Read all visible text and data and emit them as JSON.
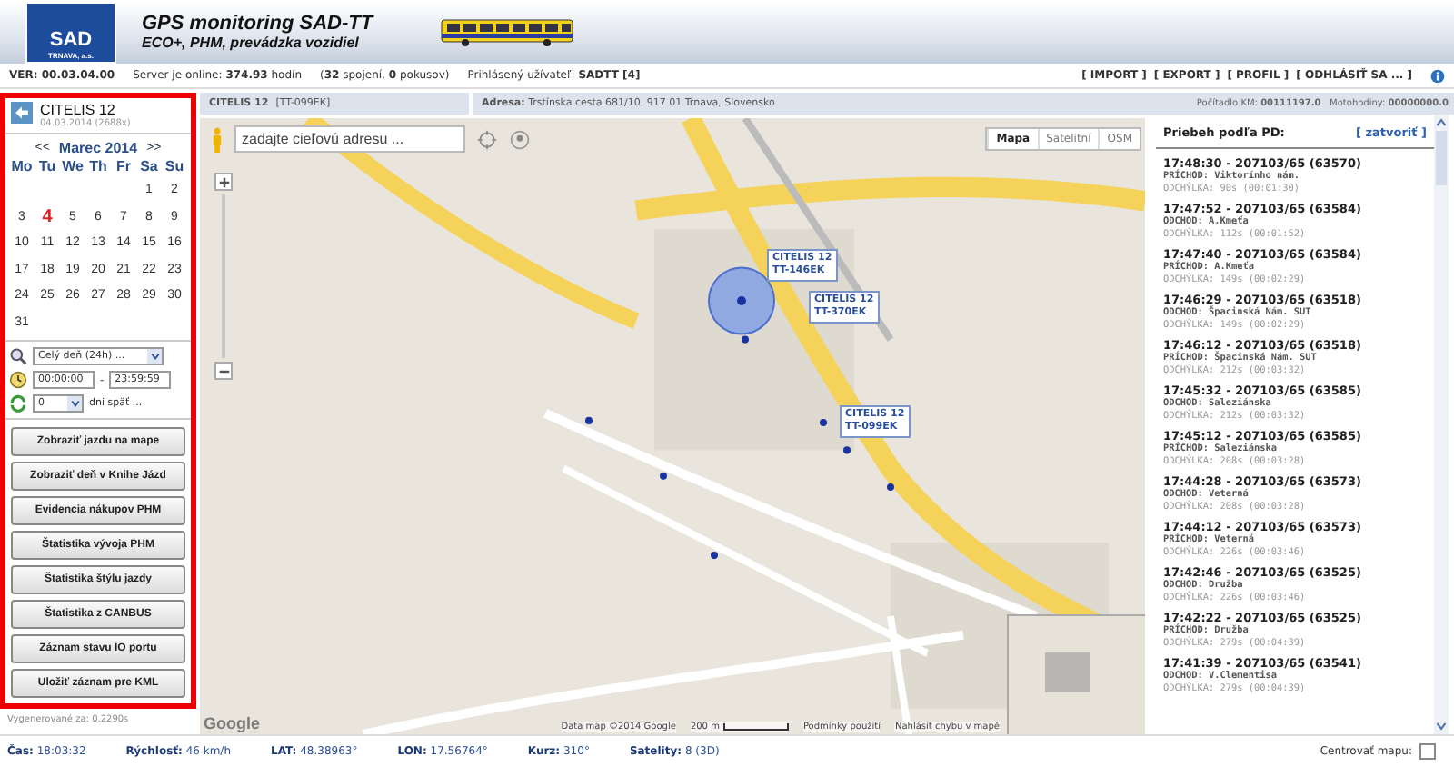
{
  "header": {
    "logo_text": "SAD",
    "logo_subtext": "TRNAVA, a.s.",
    "title": "GPS monitoring SAD-TT",
    "subtitle": "ECO+, PHM, prevádzka vozidiel"
  },
  "info_bar": {
    "version": "VER: 00.03.04.00",
    "server": "Server je online: **374.93** hodín",
    "connections": "(**32** spojení, **0** pokusov)",
    "user": "Prihlásený užívateľ: **SADTT [4]**",
    "links": [
      "[ IMPORT ]",
      "[ EXPORT ]",
      "[ PROFIL ]",
      "[ ODHLÁSIŤ SA ... ]"
    ]
  },
  "vehicle": {
    "name": "CITELIS 12",
    "subtitle": "04.03.2014 (2688x)"
  },
  "calendar": {
    "prev": "<<",
    "month": "Marec 2014",
    "next": ">>",
    "weekdays": [
      "Mo",
      "Tu",
      "We",
      "Th",
      "Fr",
      "Sa",
      "Su"
    ],
    "weeks": [
      [
        {
          "kind": "blank"
        },
        {
          "kind": "blank"
        },
        {
          "kind": "blank"
        },
        {
          "kind": "blank"
        },
        {
          "kind": "blank"
        },
        {
          "kind": "day",
          "d": "1",
          "selected": false
        },
        {
          "kind": "day",
          "d": "2",
          "selected": false
        }
      ],
      [
        {
          "d": "3",
          "selected": false
        },
        {
          "d": "4",
          "selected": true
        },
        {
          "d": "5",
          "selected": false
        },
        {
          "d": "6",
          "selected": false
        },
        {
          "d": "7",
          "selected": false
        },
        {
          "d": "8",
          "selected": false
        },
        {
          "d": "9",
          "selected": false
        }
      ],
      [
        {
          "d": "10",
          "selected": false
        },
        {
          "d": "11",
          "selected": false
        },
        {
          "d": "12",
          "selected": false
        },
        {
          "d": "13",
          "selected": false
        },
        {
          "d": "14",
          "selected": false
        },
        {
          "d": "15",
          "selected": false
        },
        {
          "d": "16",
          "selected": false
        }
      ],
      [
        {
          "d": "17",
          "selected": false
        },
        {
          "d": "18",
          "selected": false
        },
        {
          "d": "19",
          "selected": false
        },
        {
          "d": "20",
          "selected": false
        },
        {
          "d": "21",
          "selected": false
        },
        {
          "d": "22",
          "selected": false
        },
        {
          "d": "23",
          "selected": false
        }
      ],
      [
        {
          "d": "24",
          "selected": false
        },
        {
          "d": "25",
          "selected": false
        },
        {
          "d": "26",
          "selected": false
        },
        {
          "d": "27",
          "selected": false
        },
        {
          "d": "28",
          "selected": false
        },
        {
          "d": "29",
          "selected": false
        },
        {
          "d": "30",
          "selected": false
        }
      ],
      [
        {
          "kind": "day",
          "d": "31",
          "selected": false
        },
        {
          "kind": "blank"
        },
        {
          "kind": "blank"
        },
        {
          "kind": "blank"
        },
        {
          "kind": "blank"
        },
        {
          "kind": "blank"
        },
        {
          "kind": "blank"
        }
      ]
    ]
  },
  "filters": {
    "period": "Celý deň (24h) ...",
    "time_from": "00:00:00",
    "time_separator": "-",
    "time_to": "23:59:59",
    "days_back": "0",
    "days_back_label": "dni späť ..."
  },
  "buttons": [
    "Zobraziť jazdu na mape",
    "Zobraziť deň v Knihe Jázd",
    "Evidencia nákupov PHM",
    "Štatistika vývoja PHM",
    "Štatistika štýlu jazdy",
    "Štatistika z CANBUS",
    "Záznam stavu IO portu",
    "Uložiť záznam pre KML"
  ],
  "generated": "Vygenerované za: 0.2290s",
  "map_bar": {
    "vehicle": "CITELIS 12",
    "plate": "[TT-099EK]",
    "address": "**Adresa:** Trstínska cesta 681/10, 917 01 Trnava, Slovensko",
    "counters": "Počítadlo KM: **00111197.0**   Motohodiny: **00000000.0**"
  },
  "map": {
    "search_placeholder": "zadajte cieľovú adresu ...",
    "types": [
      {
        "label": "Mapa",
        "selected": true
      },
      {
        "label": "Satelitní",
        "selected": false
      },
      {
        "label": "OSM",
        "selected": false
      }
    ],
    "vehicles": [
      {
        "name": "CITELIS 12",
        "plate": "TT-146EK"
      },
      {
        "name": "CITELIS 12",
        "plate": "TT-370EK"
      },
      {
        "name": "CITELIS 12",
        "plate": "TT-099EK"
      }
    ],
    "logo": "Google",
    "attribution": "Data map ©2014 Google",
    "scale": "200 m",
    "terms": "Podmínky použití",
    "report": "Nahlásit chybu v mapě"
  },
  "timeline": {
    "title": "Priebeh podľa PD:",
    "close": "[ zatvoriť ]",
    "entries": [
      {
        "time": "17:48:30 - 207103/65 (63570)",
        "event": "PRÍCHOD: Viktorínho nám.",
        "deviation": "ODCHÝLKA: 90s (00:01:30)"
      },
      {
        "time": "17:47:52 - 207103/65 (63584)",
        "event": "ODCHOD: A.Kmeťa",
        "deviation": "ODCHÝLKA: 112s (00:01:52)"
      },
      {
        "time": "17:47:40 - 207103/65 (63584)",
        "event": "PRÍCHOD: A.Kmeťa",
        "deviation": "ODCHÝLKA: 149s (00:02:29)"
      },
      {
        "time": "17:46:29 - 207103/65 (63518)",
        "event": "ODCHOD: Špacinská Nám. SUT",
        "deviation": "ODCHÝLKA: 149s (00:02:29)"
      },
      {
        "time": "17:46:12 - 207103/65 (63518)",
        "event": "PRÍCHOD: Špacinská Nám. SUT",
        "deviation": "ODCHÝLKA: 212s (00:03:32)"
      },
      {
        "time": "17:45:32 - 207103/65 (63585)",
        "event": "ODCHOD: Saleziánska",
        "deviation": "ODCHÝLKA: 212s (00:03:32)"
      },
      {
        "time": "17:45:12 - 207103/65 (63585)",
        "event": "PRÍCHOD: Saleziánska",
        "deviation": "ODCHÝLKA: 208s (00:03:28)"
      },
      {
        "time": "17:44:28 - 207103/65 (63573)",
        "event": "ODCHOD: Veterná",
        "deviation": "ODCHÝLKA: 208s (00:03:28)"
      },
      {
        "time": "17:44:12 - 207103/65 (63573)",
        "event": "PRÍCHOD: Veterná",
        "deviation": "ODCHÝLKA: 226s (00:03:46)"
      },
      {
        "time": "17:42:46 - 207103/65 (63525)",
        "event": "ODCHOD: Družba",
        "deviation": "ODCHÝLKA: 226s (00:03:46)"
      },
      {
        "time": "17:42:22 - 207103/65 (63525)",
        "event": "PRÍCHOD: Družba",
        "deviation": "ODCHÝLKA: 279s (00:04:39)"
      },
      {
        "time": "17:41:39 - 207103/65 (63541)",
        "event": "ODCHOD: V.Clementisa",
        "deviation": "ODCHÝLKA: 279s (00:04:39)"
      }
    ]
  },
  "status_bar": {
    "items": [
      {
        "label": "Čas:",
        "value": "18:03:32"
      },
      {
        "label": "Rýchlosť:",
        "value": "46 km/h"
      },
      {
        "label": "LAT:",
        "value": "48.38963°"
      },
      {
        "label": "LON:",
        "value": "17.56764°"
      },
      {
        "label": "Kurz:",
        "value": "310°"
      },
      {
        "label": "Satelity:",
        "value": "8 (3D)"
      }
    ],
    "center_label": "Centrovať mapu:",
    "center_checked": false
  }
}
